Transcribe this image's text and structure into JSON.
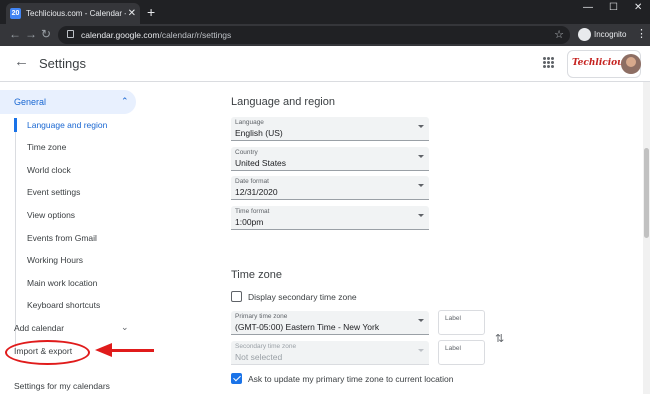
{
  "browser": {
    "tab_title": "Techlicious.com - Calendar - Gen",
    "favicon_text": "20",
    "url_host": "calendar.google.com",
    "url_path": "/calendar/r/settings",
    "incognito_label": "Incognito"
  },
  "header": {
    "title": "Settings",
    "logo_text": "Techlicious"
  },
  "sidebar": {
    "section_general": "General",
    "items": [
      {
        "label": "Language and region",
        "active": true
      },
      {
        "label": "Time zone"
      },
      {
        "label": "World clock"
      },
      {
        "label": "Event settings"
      },
      {
        "label": "View options"
      },
      {
        "label": "Events from Gmail"
      },
      {
        "label": "Working Hours"
      },
      {
        "label": "Main work location"
      },
      {
        "label": "Keyboard shortcuts"
      }
    ],
    "add_calendar": "Add calendar",
    "import_export": "Import & export",
    "my_calendars": "Settings for my calendars"
  },
  "language_region": {
    "heading": "Language and region",
    "fields": [
      {
        "label": "Language",
        "value": "English (US)"
      },
      {
        "label": "Country",
        "value": "United States"
      },
      {
        "label": "Date format",
        "value": "12/31/2020"
      },
      {
        "label": "Time format",
        "value": "1:00pm"
      }
    ]
  },
  "time_zone": {
    "heading": "Time zone",
    "secondary_checkbox_label": "Display secondary time zone",
    "secondary_checked": false,
    "primary_label": "Primary time zone",
    "primary_value": "(GMT-05:00) Eastern Time - New York",
    "secondary_label": "Secondary time zone",
    "secondary_value": "Not selected",
    "label_field": "Label",
    "ask_update_label": "Ask to update my primary time zone to current location",
    "ask_update_checked": true
  },
  "colors": {
    "accent": "#1a73e8",
    "annotation_red": "#e01b1b"
  }
}
